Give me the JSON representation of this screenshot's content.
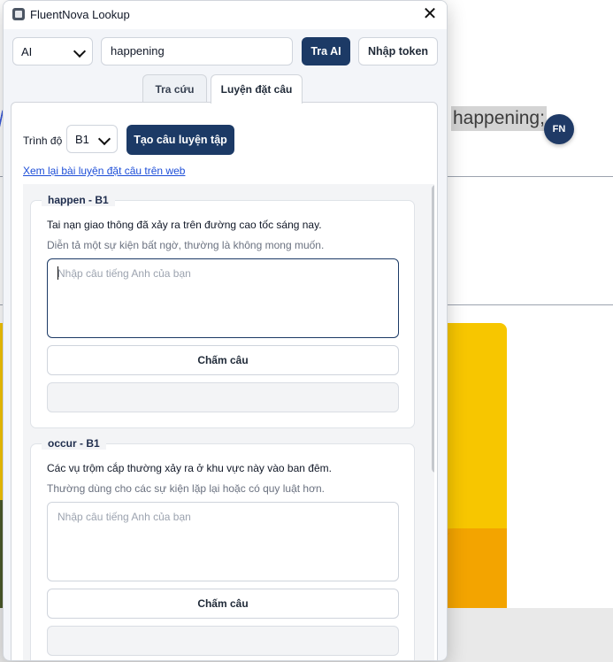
{
  "background": {
    "highlight_text": "happening;",
    "badge_text": "FN"
  },
  "window": {
    "title": "FluentNova Lookup",
    "close_label": "✕"
  },
  "toolbar": {
    "provider_select": "AI",
    "search_value": "happening",
    "lookup_ai_label": "Tra AI",
    "token_label": "Nhập token"
  },
  "tabs": [
    {
      "label": "Tra cứu",
      "active": false
    },
    {
      "label": "Luyện đặt câu",
      "active": true
    }
  ],
  "practice": {
    "level_label": "Trình độ",
    "level_value": "B1",
    "generate_label": "Tạo câu luyện tập",
    "review_link": "Xem lại bài luyện đặt câu trên web",
    "items": [
      {
        "legend": "happen - B1",
        "sentence": "Tai nạn giao thông đã xảy ra trên đường cao tốc sáng nay.",
        "hint": "Diễn tả một sự kiện bất ngờ, thường là không mong muốn.",
        "placeholder": "Nhập câu tiếng Anh của bạn",
        "grade_label": "Chấm câu"
      },
      {
        "legend": "occur - B1",
        "sentence": "Các vụ trộm cắp thường xảy ra ở khu vực này vào ban đêm.",
        "hint": "Thường dùng cho các sự kiện lặp lại hoặc có quy luật hơn.",
        "placeholder": "Nhập câu tiếng Anh của bạn",
        "grade_label": "Chấm câu"
      }
    ]
  }
}
